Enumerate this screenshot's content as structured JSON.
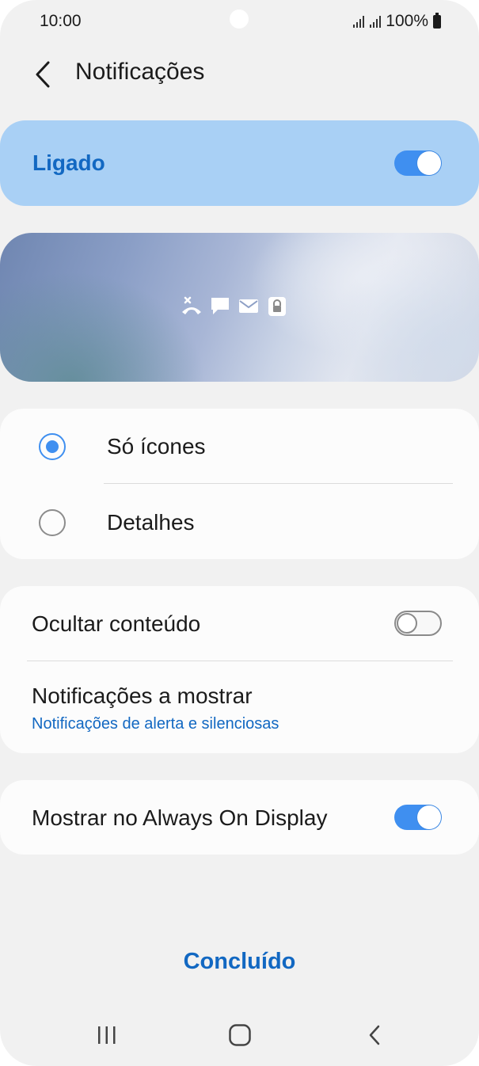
{
  "status_bar": {
    "time": "10:00",
    "battery": "100%"
  },
  "header": {
    "title": "Notificações"
  },
  "master_switch": {
    "label": "Ligado",
    "state": "on"
  },
  "preview": {
    "icons": [
      "missed-call-icon",
      "message-icon",
      "mail-icon",
      "lock-icon"
    ]
  },
  "style_options": {
    "items": [
      {
        "label": "Só ícones",
        "selected": true
      },
      {
        "label": "Detalhes",
        "selected": false
      }
    ]
  },
  "settings": {
    "hide_content": {
      "label": "Ocultar conteúdo",
      "state": "off"
    },
    "notifications_to_show": {
      "label": "Notificações a mostrar",
      "value": "Notificações de alerta e silenciosas"
    }
  },
  "aod": {
    "label": "Mostrar no Always On Display",
    "state": "on"
  },
  "footer": {
    "done_label": "Concluído"
  },
  "colors": {
    "accent": "#3f8ff0",
    "link": "#1268c2",
    "master_bg": "#a9d0f5",
    "background": "#f1f1f1"
  }
}
